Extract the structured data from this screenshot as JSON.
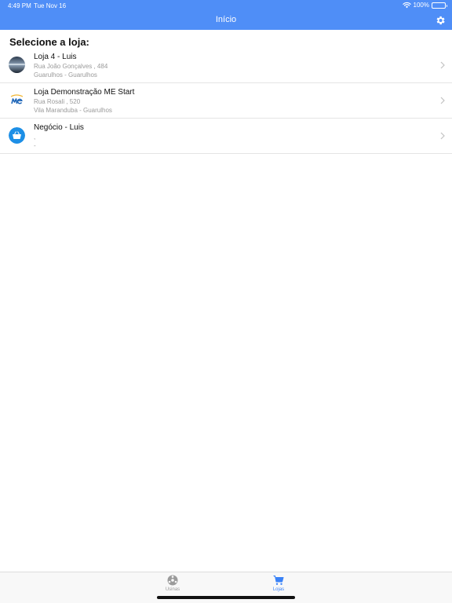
{
  "status_bar": {
    "time": "4:49 PM",
    "date": "Tue Nov 16",
    "battery": "100%"
  },
  "nav": {
    "title": "Início"
  },
  "section_title": "Selecione a loja:",
  "stores": [
    {
      "name": "Loja 4 - Luis",
      "address": "Rua João Gonçalves , 484",
      "district": "Guarulhos - Guarulhos"
    },
    {
      "name": "Loja Demonstração ME Start",
      "address": "Rua Rosali , 520",
      "district": "Vila Maranduba - Guarulhos"
    },
    {
      "name": "Negócio - Luis",
      "address": ",",
      "district": "-"
    }
  ],
  "tabs": [
    {
      "label": "Usinas",
      "icon": "ball-icon",
      "active": false
    },
    {
      "label": "Lojas",
      "icon": "cart-icon",
      "active": true
    }
  ],
  "colors": {
    "accent": "#4f8ef7",
    "active_tab": "#3a82f7",
    "inactive_tab": "#9b9b9b"
  }
}
